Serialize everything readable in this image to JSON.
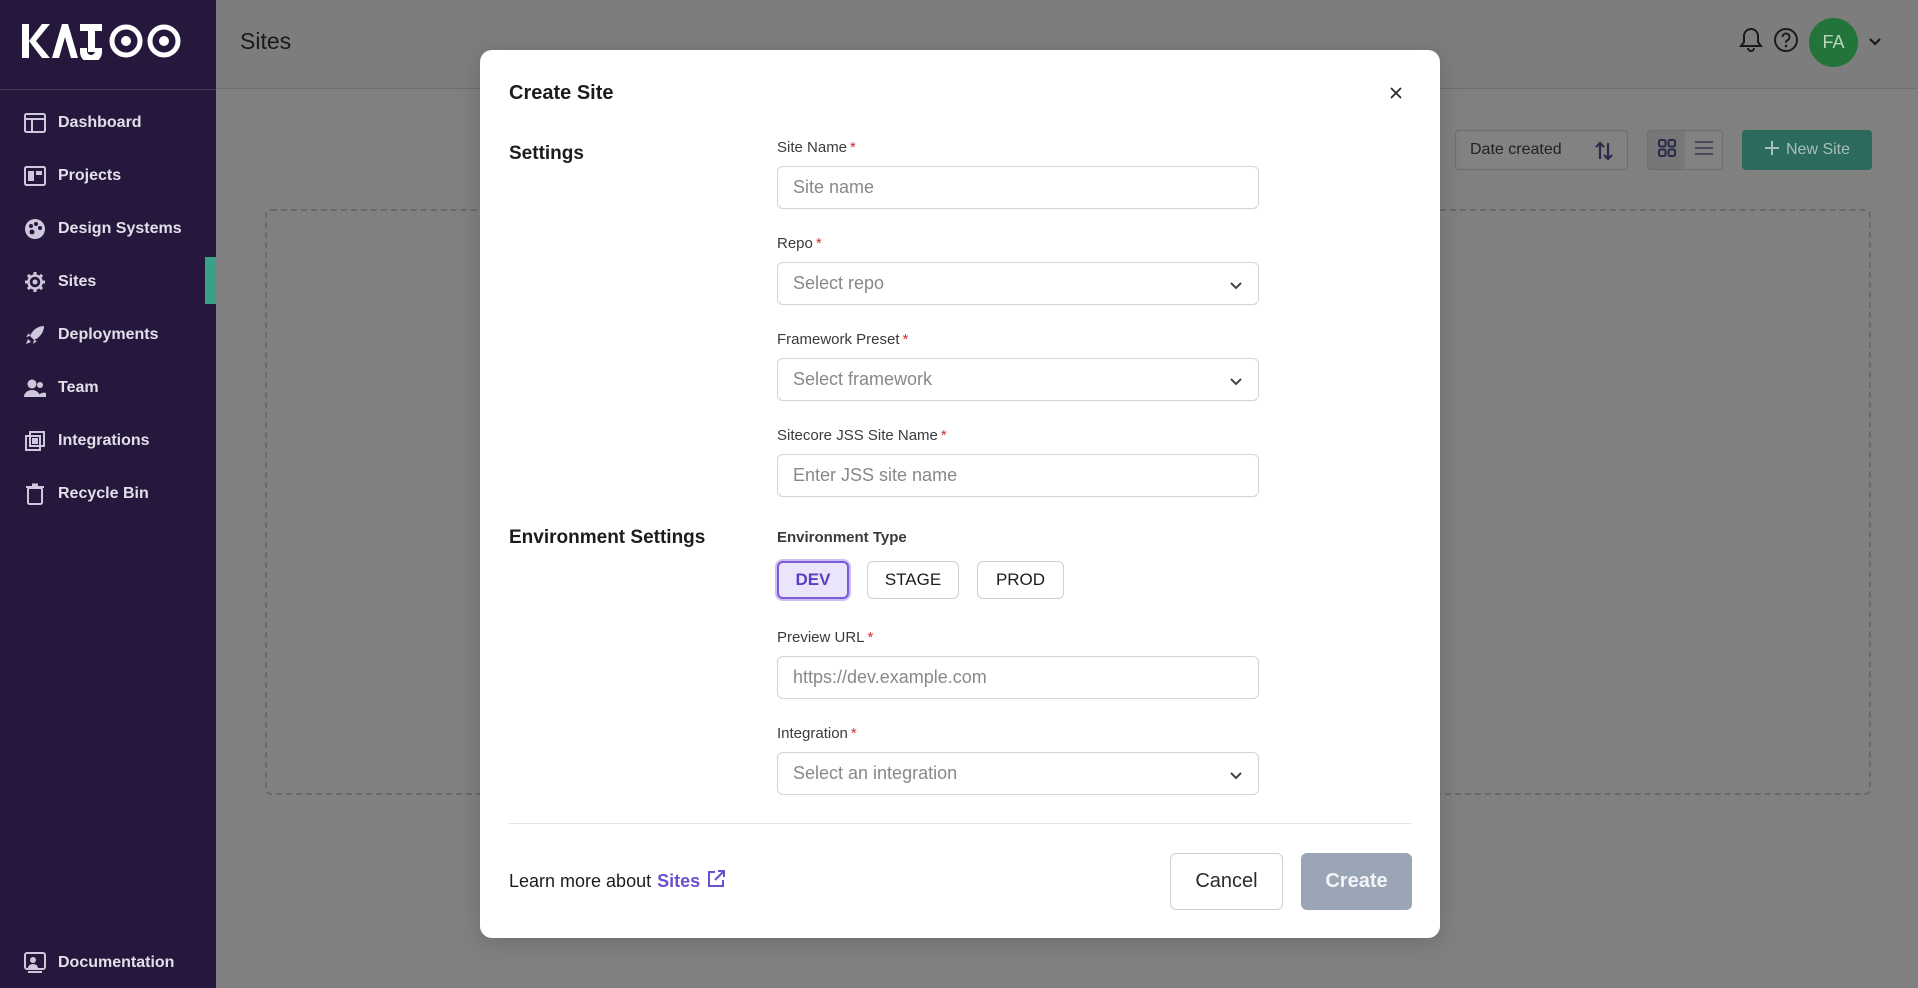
{
  "brand": {
    "logo_text": "KAJOO"
  },
  "sidebar": {
    "items": [
      {
        "label": "Dashboard",
        "icon": "dashboard-icon"
      },
      {
        "label": "Projects",
        "icon": "projects-icon"
      },
      {
        "label": "Design Systems",
        "icon": "palette-icon"
      },
      {
        "label": "Sites",
        "icon": "gear-icon",
        "active": true
      },
      {
        "label": "Deployments",
        "icon": "rocket-icon"
      },
      {
        "label": "Team",
        "icon": "team-icon"
      },
      {
        "label": "Integrations",
        "icon": "integrations-icon"
      },
      {
        "label": "Recycle Bin",
        "icon": "trash-icon"
      }
    ],
    "documentation": {
      "label": "Documentation",
      "icon": "documentation-icon"
    }
  },
  "header": {
    "title": "Sites",
    "avatar_initials": "FA"
  },
  "toolbar": {
    "sort_label": "Date created",
    "new_site_label": "New Site"
  },
  "modal": {
    "title": "Create Site",
    "settings_title": "Settings",
    "env_settings_title": "Environment Settings",
    "fields": {
      "site_name": {
        "label": "Site Name",
        "placeholder": "Site name"
      },
      "repo": {
        "label": "Repo",
        "placeholder": "Select repo"
      },
      "framework": {
        "label": "Framework Preset",
        "placeholder": "Select framework"
      },
      "jss_name": {
        "label": "Sitecore JSS Site Name",
        "placeholder": "Enter JSS site name"
      },
      "preview_url": {
        "label": "Preview URL",
        "placeholder": "https://dev.example.com"
      },
      "integration": {
        "label": "Integration",
        "placeholder": "Select an integration"
      }
    },
    "required_mark": "*",
    "env_type": {
      "label": "Environment Type",
      "options": [
        "DEV",
        "STAGE",
        "PROD"
      ],
      "selected": "DEV"
    },
    "footer": {
      "learn_text": "Learn more about",
      "learn_link": "Sites",
      "cancel_label": "Cancel",
      "create_label": "Create"
    }
  },
  "colors": {
    "sidebar_bg": "#25183c",
    "accent_purple": "#6b4fd1",
    "active_marker": "#3aa088",
    "create_disabled": "#9aa6b6"
  }
}
